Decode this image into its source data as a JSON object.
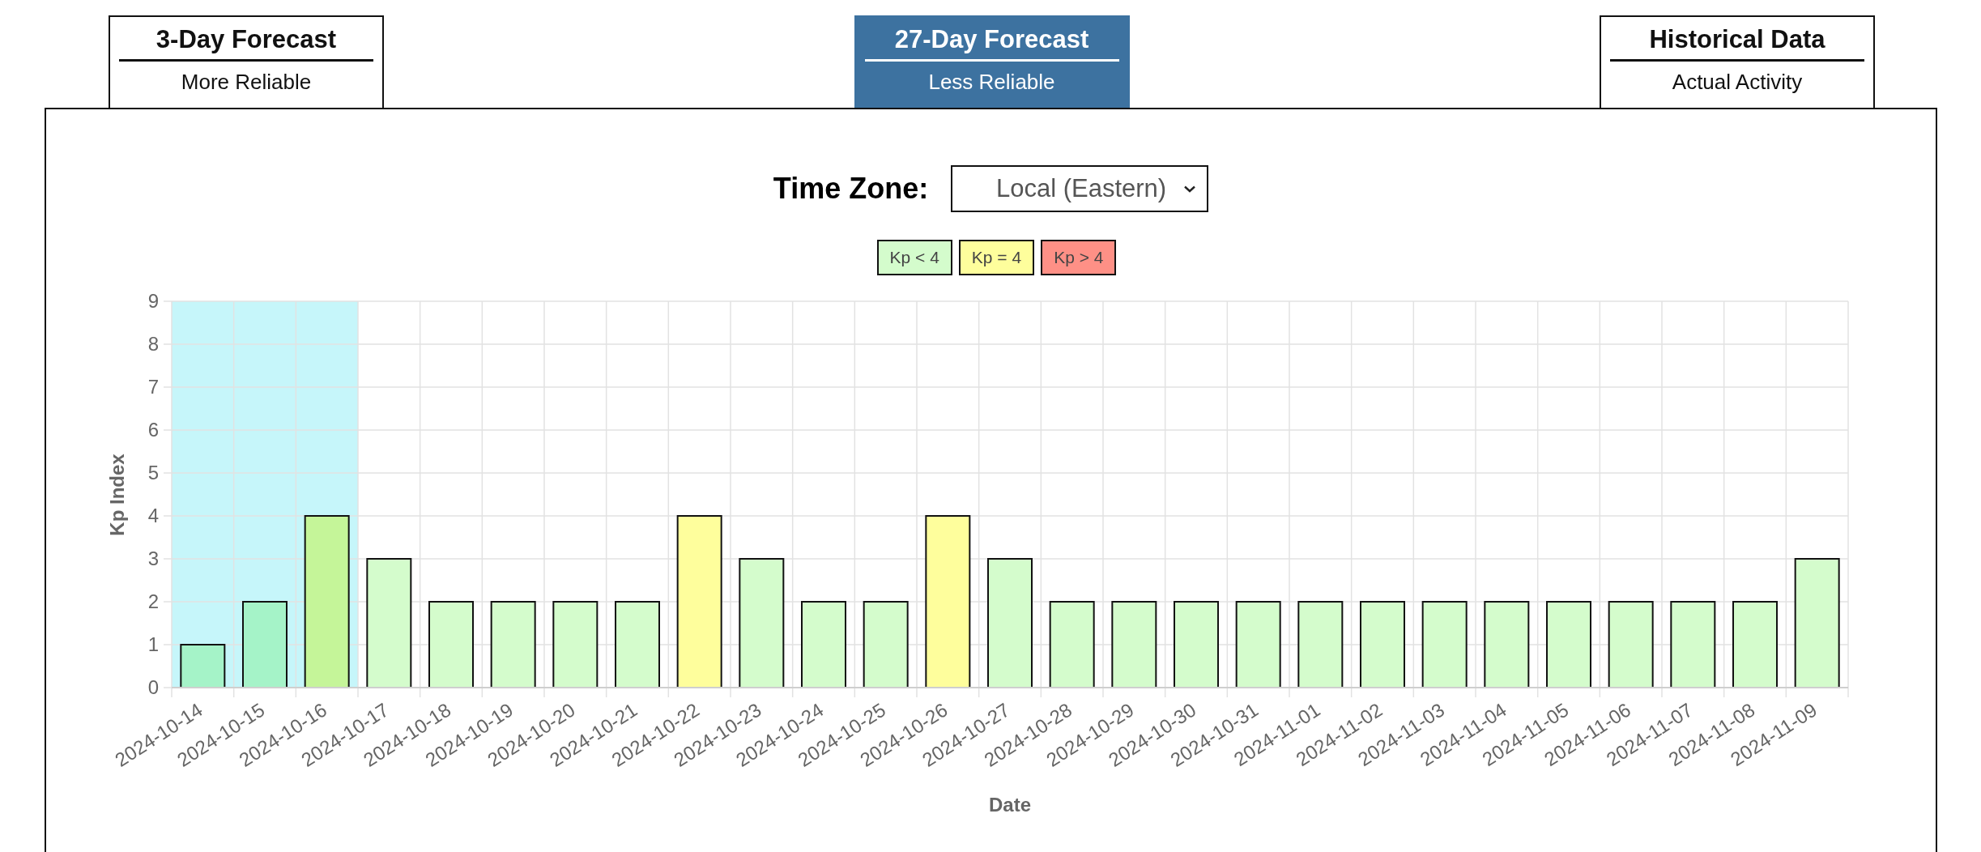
{
  "tabs": [
    {
      "title": "3-Day Forecast",
      "subtitle": "More Reliable",
      "selected": false
    },
    {
      "title": "27-Day Forecast",
      "subtitle": "Less Reliable",
      "selected": true
    },
    {
      "title": "Historical Data",
      "subtitle": "Actual Activity",
      "selected": false
    }
  ],
  "time_zone": {
    "label": "Time Zone:",
    "value": "Local (Eastern)"
  },
  "legend": [
    {
      "label": "Kp < 4",
      "color": "#d4fccc"
    },
    {
      "label": "Kp = 4",
      "color": "#fefe9c"
    },
    {
      "label": "Kp > 4",
      "color": "#fe9086"
    }
  ],
  "chart_data": {
    "type": "bar",
    "xlabel": "Date",
    "ylabel": "Kp Index",
    "categories": [
      "2024-10-14",
      "2024-10-15",
      "2024-10-16",
      "2024-10-17",
      "2024-10-18",
      "2024-10-19",
      "2024-10-20",
      "2024-10-21",
      "2024-10-22",
      "2024-10-23",
      "2024-10-24",
      "2024-10-25",
      "2024-10-26",
      "2024-10-27",
      "2024-10-28",
      "2024-10-29",
      "2024-10-30",
      "2024-10-31",
      "2024-11-01",
      "2024-11-02",
      "2024-11-03",
      "2024-11-04",
      "2024-11-05",
      "2024-11-06",
      "2024-11-07",
      "2024-11-08",
      "2024-11-09"
    ],
    "values": [
      1,
      2,
      4,
      3,
      2,
      2,
      2,
      2,
      4,
      3,
      2,
      2,
      4,
      3,
      2,
      2,
      2,
      2,
      2,
      2,
      2,
      2,
      2,
      2,
      2,
      2,
      3
    ],
    "ylim": [
      0,
      9
    ],
    "yticks": [
      0,
      1,
      2,
      3,
      4,
      5,
      6,
      7,
      8,
      9
    ],
    "grid": true,
    "bands": [
      {
        "axis": "x",
        "from": "2024-10-14",
        "to": "2024-10-16",
        "color": "#c6f6fa"
      }
    ]
  }
}
